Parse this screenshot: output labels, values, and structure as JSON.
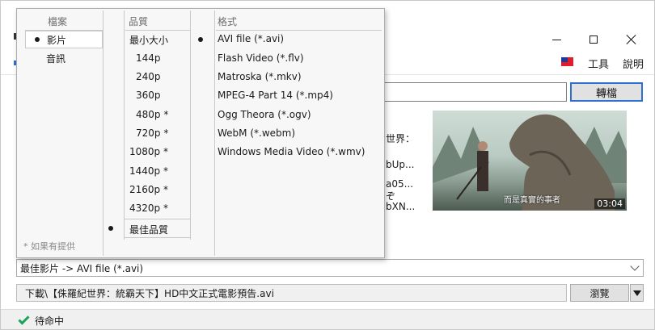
{
  "window": {
    "menu": {
      "tools_label": "工具",
      "help_label": "說明"
    },
    "convert_label": "轉檔",
    "video_info": {
      "lines": [
        "世界：",
        "bUp...",
        "a05...",
        "ぞ",
        "bXN..."
      ]
    },
    "thumbnail": {
      "subtitle": "而是真實的事者",
      "duration": "03:04"
    },
    "format_select_value": "最佳影片 -> AVI file (*.avi)",
    "save_path": "下載\\【侏羅紀世界：統霸天下】HD中文正式電影預告.avi",
    "browse_label": "瀏覽",
    "status_text": "待命中",
    "colors": {
      "accent": "#2f6fcf",
      "ok": "#1aa35a"
    }
  },
  "popup": {
    "file_header": "檔案",
    "file_items": [
      {
        "label": "影片",
        "selected": true
      },
      {
        "label": "音訊",
        "selected": false
      }
    ],
    "footnote": "* 如果有提供",
    "quality_header": "品質",
    "quality_items": [
      {
        "label": "最小大小",
        "selected": false
      },
      {
        "label": "144p",
        "selected": false
      },
      {
        "label": "240p",
        "selected": false
      },
      {
        "label": "360p",
        "selected": false
      },
      {
        "label": "480p *",
        "selected": false
      },
      {
        "label": "720p *",
        "selected": false
      },
      {
        "label": "1080p *",
        "selected": false
      },
      {
        "label": "1440p *",
        "selected": false
      },
      {
        "label": "2160p *",
        "selected": false
      },
      {
        "label": "4320p *",
        "selected": false
      },
      {
        "label": "最佳品質",
        "selected": true
      }
    ],
    "format_header": "格式",
    "format_items": [
      {
        "label": "AVI file (*.avi)",
        "selected": true
      },
      {
        "label": "Flash Video (*.flv)",
        "selected": false
      },
      {
        "label": "Matroska (*.mkv)",
        "selected": false
      },
      {
        "label": "MPEG-4 Part 14 (*.mp4)",
        "selected": false
      },
      {
        "label": "Ogg Theora (*.ogv)",
        "selected": false
      },
      {
        "label": "WebM (*.webm)",
        "selected": false
      },
      {
        "label": "Windows Media Video (*.wmv)",
        "selected": false
      }
    ]
  }
}
